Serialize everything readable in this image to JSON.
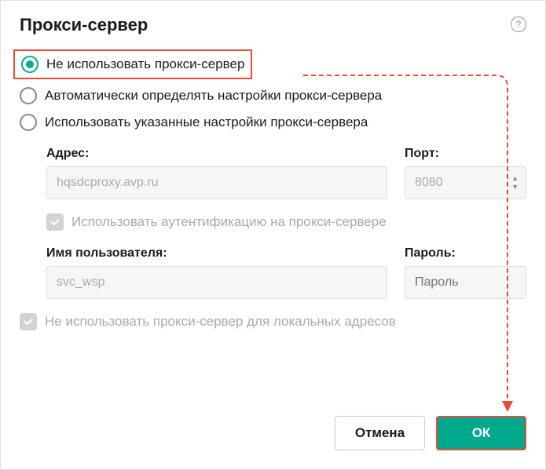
{
  "dialog": {
    "title": "Прокси-сервер"
  },
  "radio": {
    "option1": "Не использовать прокси-сервер",
    "option2": "Автоматически определять настройки прокси-сервера",
    "option3": "Использовать указанные настройки прокси-сервера"
  },
  "form": {
    "address_label": "Адрес:",
    "address_value": "hqsdcproxy.avp.ru",
    "port_label": "Порт:",
    "port_value": "8080",
    "auth_checkbox": "Использовать аутентификацию на прокси-сервере",
    "username_label": "Имя пользователя:",
    "username_value": "svc_wsp",
    "password_label": "Пароль:",
    "password_placeholder": "Пароль"
  },
  "local_checkbox": "Не использовать прокси-сервер для локальных адресов",
  "buttons": {
    "cancel": "Отмена",
    "ok": "ОК"
  }
}
